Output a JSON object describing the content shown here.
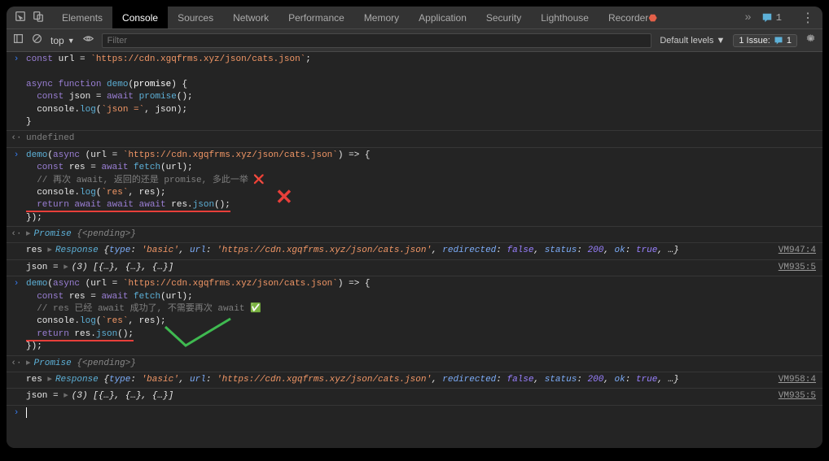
{
  "tabs": {
    "elements": "Elements",
    "console": "Console",
    "sources": "Sources",
    "network": "Network",
    "performance": "Performance",
    "memory": "Memory",
    "application": "Application",
    "security": "Security",
    "lighthouse": "Lighthouse",
    "recorder": "Recorder"
  },
  "topbadge": "1",
  "toolbar": {
    "context": "top",
    "filter_placeholder": "Filter",
    "levels": "Default levels",
    "issues": "1 Issue:",
    "issues_count": "1"
  },
  "code1": {
    "l1a": "const",
    "l1b": " url = ",
    "l1c": "`https://cdn.xgqfrms.xyz/json/cats.json`",
    "l1d": ";",
    "l3a": "async function",
    "l3b": " demo",
    "l3c": "(",
    "l3d": "promise",
    "l3e": ") {",
    "l4a": "  const",
    "l4b": " json = ",
    "l4c": "await",
    "l4d": " promise",
    "l4e": "();",
    "l5a": "  console.",
    "l5b": "log",
    "l5c": "(",
    "l5d": "`json =`",
    "l5e": ", json);",
    "l6": "}"
  },
  "result1": "undefined",
  "code2": {
    "l1a": "demo",
    "l1b": "(",
    "l1c": "async",
    "l1d": " (url = ",
    "l1e": "`https://cdn.xgqfrms.xyz/json/cats.json`",
    "l1f": ") => {",
    "l2a": "  const",
    "l2b": " res = ",
    "l2c": "await",
    "l2d": " fetch",
    "l2e": "(url);",
    "l3": "  // 再次 await, 返回的还是 promise, 多此一举 ❌",
    "l4a": "  console.",
    "l4b": "log",
    "l4c": "(",
    "l4d": "`res`",
    "l4e": ", res);",
    "l5a": "  return",
    "l5b": " await",
    "l5c": " await",
    "l5d": " await",
    "l5e": " res.",
    "l5f": "json",
    "l5g": "();",
    "l6": "});"
  },
  "promise1": {
    "label": "Promise ",
    "pending": "{<pending>}"
  },
  "resp1": {
    "res": "res ",
    "cls": "Response ",
    "open": "{",
    "type_k": "type",
    "type_v": "'basic'",
    "url_k": "url",
    "url_v": "'https://cdn.xgqfrms.xyz/json/cats.json'",
    "redir_k": "redirected",
    "redir_v": "false",
    "status_k": "status",
    "status_v": "200",
    "ok_k": "ok",
    "ok_v": "true",
    "rest": ", …}",
    "src": "VM947:4"
  },
  "json1": {
    "pre": "json = ",
    "val": "(3) [{…}, {…}, {…}]",
    "src": "VM935:5"
  },
  "code3": {
    "l1a": "demo",
    "l1b": "(",
    "l1c": "async",
    "l1d": " (url = ",
    "l1e": "`https://cdn.xgqfrms.xyz/json/cats.json`",
    "l1f": ") => {",
    "l2a": "  const",
    "l2b": " res = ",
    "l2c": "await",
    "l2d": " fetch",
    "l2e": "(url);",
    "l3": "  // res 已经 await 成功了, 不需要再次 await ✅",
    "l4a": "  console.",
    "l4b": "log",
    "l4c": "(",
    "l4d": "`res`",
    "l4e": ", res);",
    "l5a": "  return",
    "l5b": " res.",
    "l5c": "json",
    "l5d": "();",
    "l6": "});"
  },
  "promise2": {
    "label": "Promise ",
    "pending": "{<pending>}"
  },
  "resp2": {
    "res": "res ",
    "cls": "Response ",
    "open": "{",
    "type_k": "type",
    "type_v": "'basic'",
    "url_k": "url",
    "url_v": "'https://cdn.xgqfrms.xyz/json/cats.json'",
    "redir_k": "redirected",
    "redir_v": "false",
    "status_k": "status",
    "status_v": "200",
    "ok_k": "ok",
    "ok_v": "true",
    "rest": ", …}",
    "src": "VM958:4"
  },
  "json2": {
    "pre": "json = ",
    "val": "(3) [{…}, {…}, {…}]",
    "src": "VM935:5"
  }
}
